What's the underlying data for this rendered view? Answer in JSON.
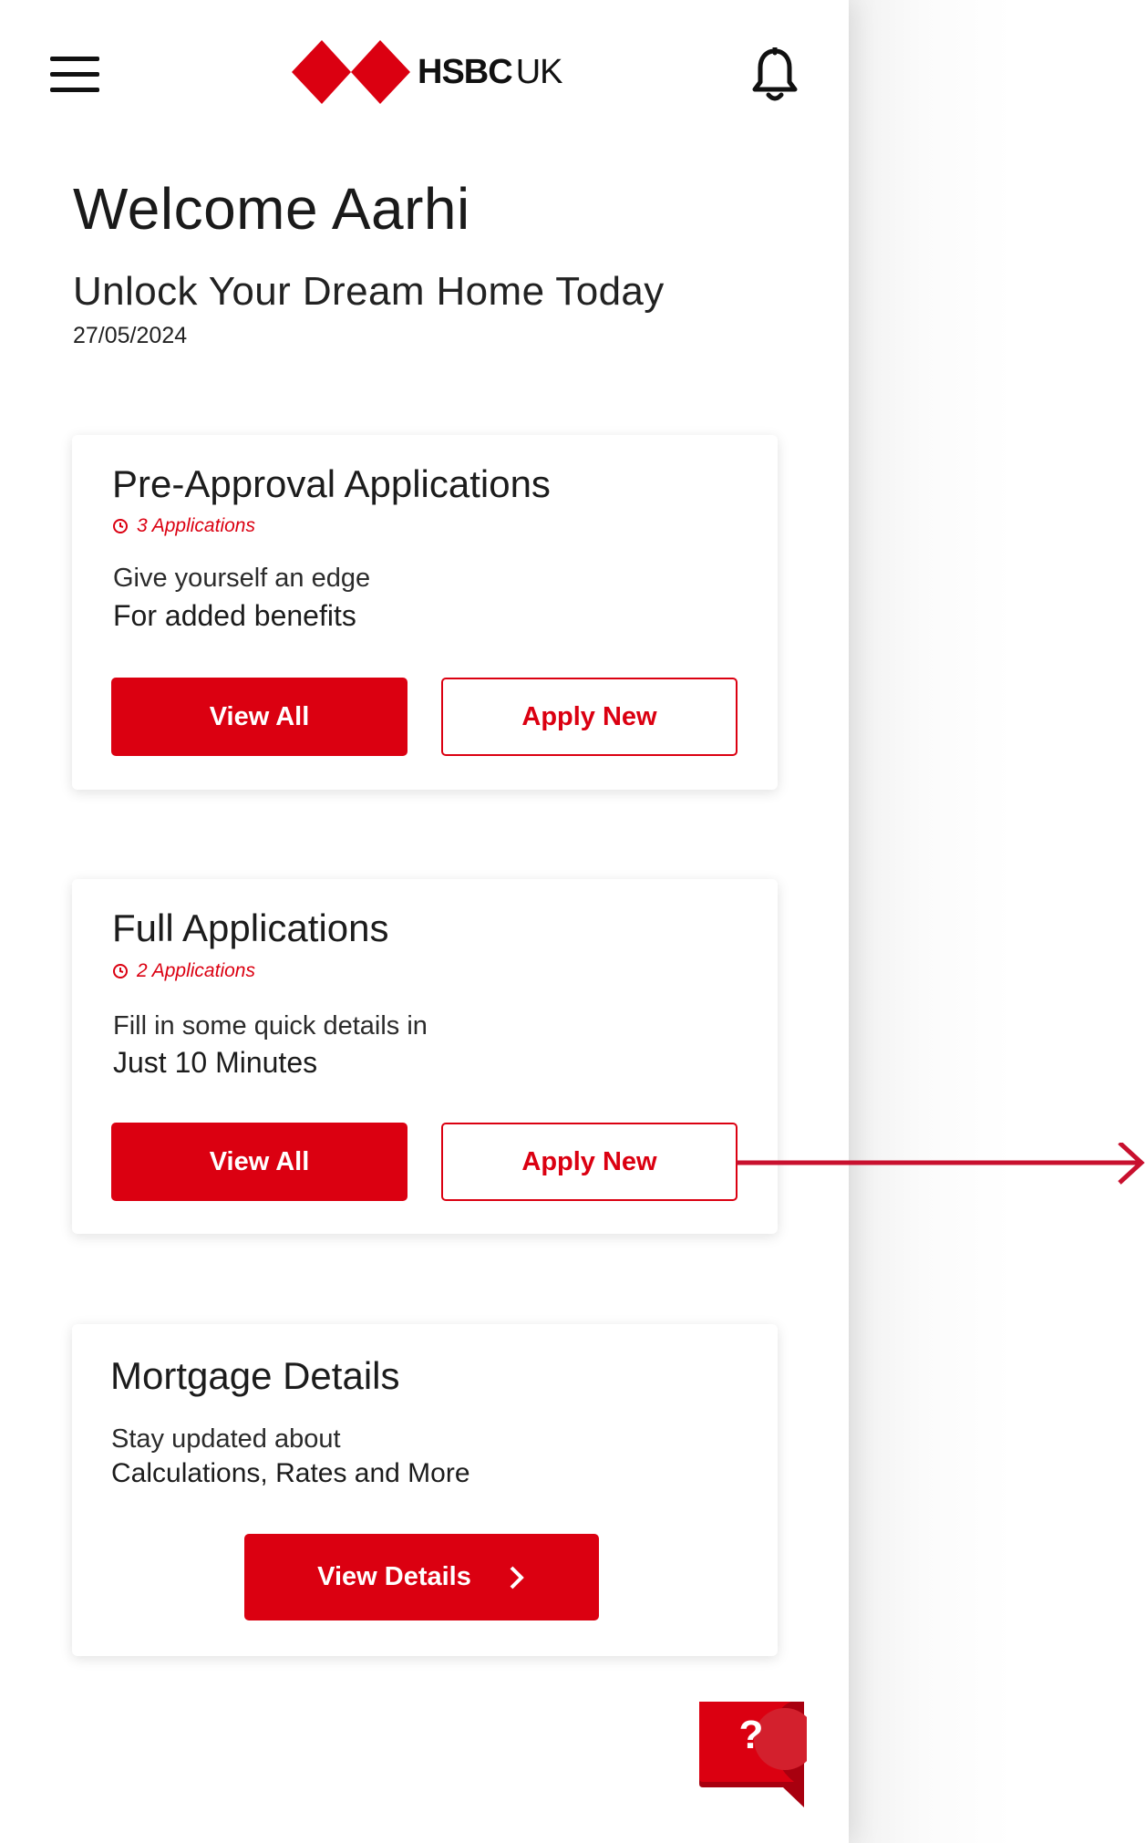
{
  "header": {
    "brand_bold": "HSBC",
    "brand_region": "UK",
    "menu_icon": "hamburger-menu-icon",
    "notification_icon": "bell-icon"
  },
  "hero": {
    "welcome": "Welcome Aarhi",
    "subtitle": "Unlock Your Dream Home Today",
    "date": "27/05/2024"
  },
  "cards": [
    {
      "title": "Pre-Approval Applications",
      "badge": "3 Applications",
      "line1": "Give yourself an edge",
      "line2": "For added benefits",
      "primary_label": "View All",
      "secondary_label": "Apply New"
    },
    {
      "title": "Full Applications",
      "badge": "2 Applications",
      "line1": "Fill in some quick details in",
      "line2": "Just 10 Minutes",
      "primary_label": "View All",
      "secondary_label": "Apply New"
    },
    {
      "title": "Mortgage Details",
      "line1": "Stay updated about",
      "line2": "Calculations, Rates and More",
      "primary_label": "View Details"
    }
  ],
  "help": {
    "label": "?"
  },
  "colors": {
    "accent": "#db0011",
    "text": "#1c1c1c"
  }
}
